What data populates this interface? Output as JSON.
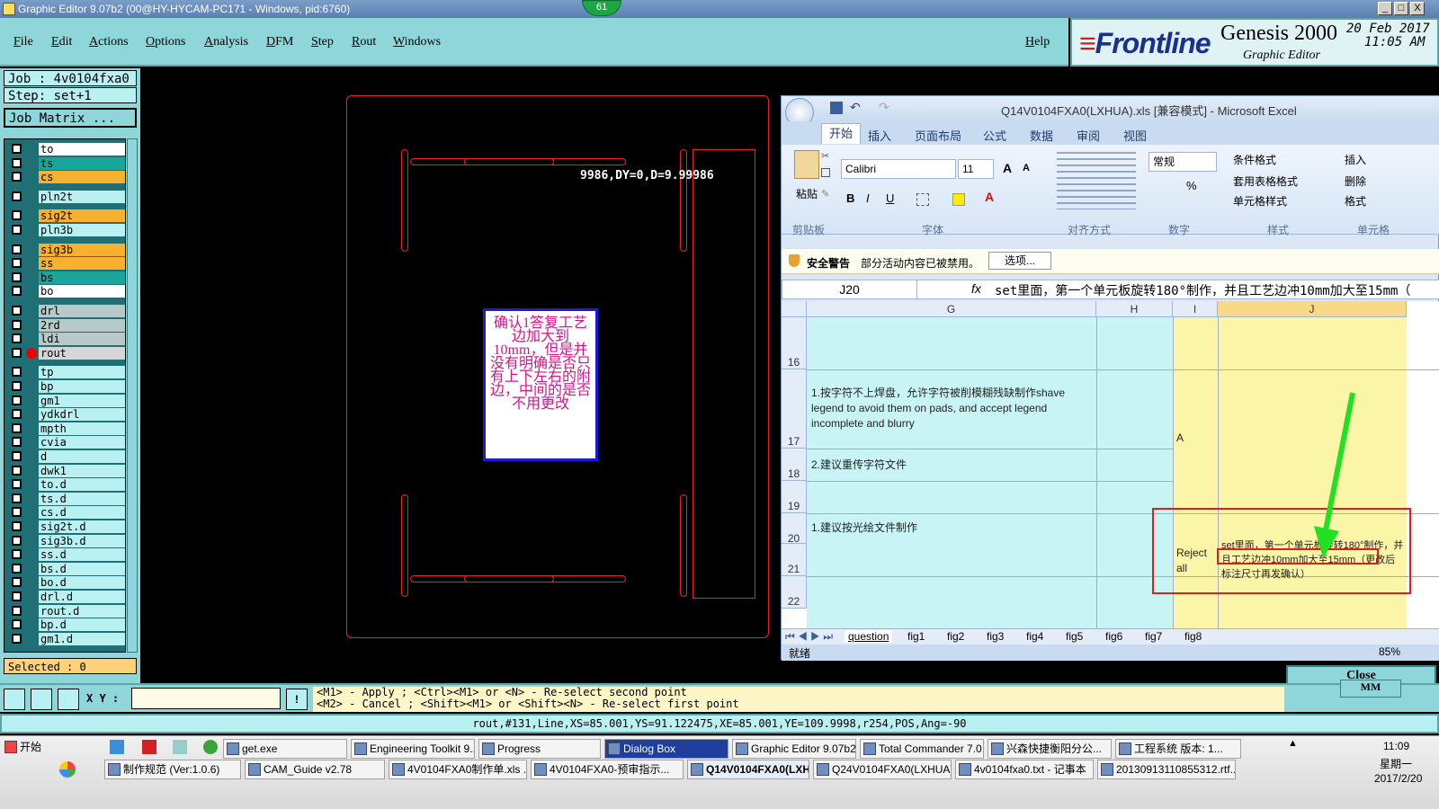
{
  "titlebar": {
    "title": "Graphic Editor 9.07b2 (00@HY-HYCAM-PC171 - Windows, pid:6760)",
    "badge": "61",
    "min": "_",
    "max": "□",
    "close": "X"
  },
  "menu": {
    "items": [
      "File",
      "Edit",
      "Actions",
      "Options",
      "Analysis",
      "DFM",
      "Step",
      "Rout",
      "Windows"
    ],
    "help": "Help"
  },
  "brand": {
    "logo_mark": "≡",
    "logo_text": "Frontline",
    "product": "Genesis 2000",
    "subtitle": "Graphic Editor",
    "date": "20 Feb 2017",
    "time": "11:05 AM"
  },
  "left": {
    "job": "Job : 4v0104fxa0",
    "step": "Step: set+1",
    "job_matrix": "Job Matrix ...",
    "selected": "Selected : 0"
  },
  "layers": [
    {
      "name": "to",
      "color": "#ffffff"
    },
    {
      "name": "ts",
      "color": "#1aa59a"
    },
    {
      "name": "cs",
      "color": "#f7b030"
    },
    {
      "name": "pln2t",
      "color": "#b9f0f2"
    },
    {
      "name": "sig2t",
      "color": "#f7b030"
    },
    {
      "name": "pln3b",
      "color": "#b9f0f2"
    },
    {
      "name": "sig3b",
      "color": "#f7b030"
    },
    {
      "name": "ss",
      "color": "#f7b030"
    },
    {
      "name": "bs",
      "color": "#1aa59a"
    },
    {
      "name": "bo",
      "color": "#ffffff"
    },
    {
      "name": "drl",
      "color": "#b7c9c9"
    },
    {
      "name": "2rd",
      "color": "#b7c9c9"
    },
    {
      "name": "ldi",
      "color": "#b7c9c9"
    },
    {
      "name": "rout",
      "color": "#d6d6d6"
    },
    {
      "name": "tp",
      "color": "#b9f0f2"
    },
    {
      "name": "bp",
      "color": "#b9f0f2"
    },
    {
      "name": "gm1",
      "color": "#b9f0f2"
    },
    {
      "name": "ydkdrl",
      "color": "#b9f0f2"
    },
    {
      "name": "mpth",
      "color": "#b9f0f2"
    },
    {
      "name": "cvia",
      "color": "#b9f0f2"
    },
    {
      "name": "d",
      "color": "#b9f0f2"
    },
    {
      "name": "dwk1",
      "color": "#b9f0f2"
    },
    {
      "name": "to.d",
      "color": "#b9f0f2"
    },
    {
      "name": "ts.d",
      "color": "#b9f0f2"
    },
    {
      "name": "cs.d",
      "color": "#b9f0f2"
    },
    {
      "name": "sig2t.d",
      "color": "#b9f0f2"
    },
    {
      "name": "sig3b.d",
      "color": "#b9f0f2"
    },
    {
      "name": "ss.d",
      "color": "#b9f0f2"
    },
    {
      "name": "bs.d",
      "color": "#b9f0f2"
    },
    {
      "name": "bo.d",
      "color": "#b9f0f2"
    },
    {
      "name": "drl.d",
      "color": "#b9f0f2"
    },
    {
      "name": "rout.d",
      "color": "#b9f0f2"
    },
    {
      "name": "bp.d",
      "color": "#b9f0f2"
    },
    {
      "name": "gm1.d",
      "color": "#b9f0f2"
    }
  ],
  "canvas": {
    "coords": "9986,DY=0,D=9.99986",
    "note": "确认1答复工艺边加大到10mm，但是并没有明确是否只有上下左右的附边，中间的是否不用更改"
  },
  "excel": {
    "title": "Q14V0104FXA0(LXHUA).xls [兼容模式] - Microsoft Excel",
    "tabs": [
      "开始",
      "插入",
      "页面布局",
      "公式",
      "数据",
      "审阅",
      "视图"
    ],
    "font": "Calibri",
    "size": "11",
    "numfmt": "常规",
    "groups": [
      "剪贴板",
      "字体",
      "对齐方式",
      "数字",
      "样式",
      "单元格"
    ],
    "paste": "粘贴",
    "styles": [
      "条件格式",
      "套用表格格式",
      "单元格样式"
    ],
    "cells_btns": [
      "插入",
      "删除",
      "格式"
    ],
    "security_title": "安全警告",
    "security_msg": "部分活动内容已被禁用。",
    "options": "选项...",
    "namebox": "J20",
    "fx": "fx",
    "formula": "set里面，第一个单元板旋转180°制作，并且工艺边冲10mm加大至15mm（",
    "cols": [
      "G",
      "H",
      "I",
      "J"
    ],
    "rows": [
      "16",
      "17",
      "18",
      "19",
      "20",
      "21",
      "22"
    ],
    "g17": "1.按字符不上焊盘，允许字符被削模糊残缺制作shave legend to avoid them on pads, and accept legend incomplete and blurry",
    "i17": "A",
    "g18": "2.建议重传字符文件",
    "g20": "1.建议按光绘文件制作",
    "i20": "Reject all",
    "j20": "set里面，第一个单元板旋转180°制作，并且工艺边冲10mm加大至15mm（更改后标注尺寸再发确认）",
    "sheets": [
      "question",
      "fig1",
      "fig2",
      "fig3",
      "fig4",
      "fig5",
      "fig6",
      "fig7",
      "fig8"
    ],
    "status": "就绪",
    "zoom": "85%"
  },
  "close": "Close",
  "mm": "MM",
  "xy_label": "X Y :",
  "msg1": "<M1> - Apply  ; <Ctrl><M1> or <N> - Re-select second point",
  "msg2": "<M2> - Cancel ; <Shift><M1> or <Shift><N> - Re-select first point",
  "status": "rout,#131,Line,XS=85.001,YS=91.122475,XE=85.001,YE=109.9998,r254,POS,Ang=-90",
  "taskbar": {
    "start": "开始",
    "row1": [
      "get.exe",
      "Engineering Toolkit 9....",
      "Progress",
      "Dialog Box",
      "Graphic Editor 9.07b2...",
      "Total Commander 7.0...",
      "兴森快捷衡阳分公...",
      "工程系统  版本: 1..."
    ],
    "row2": [
      "制作规范 (Ver:1.0.6)",
      "CAM_Guide v2.78",
      "4V0104FXA0制作单.xls ...",
      "4V0104FXA0-预审指示...",
      "Q14V0104FXA0(LXHU...",
      "Q24V0104FXA0(LXHUA)....",
      "4v0104fxa0.txt - 记事本",
      "20130913110855312.rtf..."
    ],
    "time": "11:09",
    "weekday": "星期一",
    "date": "2017/2/20"
  }
}
